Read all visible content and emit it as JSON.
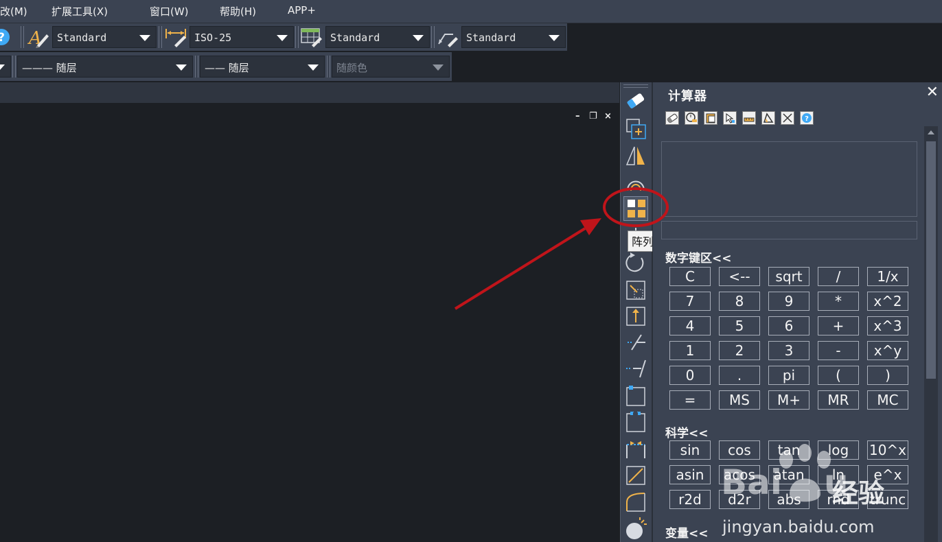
{
  "menu": [
    "改(M)",
    "扩展工具(X)",
    "窗口(W)",
    "帮助(H)",
    "APP+"
  ],
  "toolbar1": {
    "text_style": "Standard",
    "dim_style": "ISO-25",
    "table_style": "Standard",
    "mleader_style": "Standard"
  },
  "toolbar2": {
    "linetype": "——— 随层",
    "lineweight": "—— 随层",
    "color": "随颜色"
  },
  "window_controls": {
    "minimize": "–",
    "restore": "❐",
    "close": "×"
  },
  "modify_toolbar": {
    "tools": [
      "erase-icon",
      "copy-icon",
      "mirror-icon",
      "offset-icon",
      "array-icon",
      "move-icon",
      "rotate-icon",
      "scale-icon",
      "stretch-icon",
      "trim-icon",
      "extend-icon",
      "break-at-point-icon",
      "break-icon",
      "join-icon",
      "chamfer-icon",
      "fillet-icon",
      "explode-icon"
    ],
    "tooltip": "阵列"
  },
  "calculator": {
    "title": "计算器",
    "close": "✕",
    "toolbar_icons": [
      "clear-icon",
      "clear-history-icon",
      "paste-value-icon",
      "get-coordinates-icon",
      "distance-icon",
      "angle-icon",
      "intersection-icon",
      "help-icon"
    ],
    "numpad_label": "数字键区<<",
    "numpad": [
      [
        "C",
        "<--",
        "sqrt",
        "/",
        "1/x"
      ],
      [
        "7",
        "8",
        "9",
        "*",
        "x^2"
      ],
      [
        "4",
        "5",
        "6",
        "+",
        "x^3"
      ],
      [
        "1",
        "2",
        "3",
        "-",
        "x^y"
      ],
      [
        "0",
        ".",
        "pi",
        "(",
        ")"
      ],
      [
        "=",
        "MS",
        "M+",
        "MR",
        "MC"
      ]
    ],
    "science_label": "科学<<",
    "science": [
      [
        "sin",
        "cos",
        "tan",
        "log",
        "10^x"
      ],
      [
        "asin",
        "acos",
        "atan",
        "ln",
        "e^x"
      ],
      [
        "r2d",
        "d2r",
        "abs",
        "rnd",
        "trunc"
      ]
    ],
    "variables_label": "变量<<"
  },
  "watermark": {
    "brand_cn": "经验",
    "url": "jingyan.baidu.com"
  },
  "colors": {
    "annotation": "#c0141a",
    "accent_orange": "#f0b34a",
    "accent_blue": "#3fa9f5"
  }
}
